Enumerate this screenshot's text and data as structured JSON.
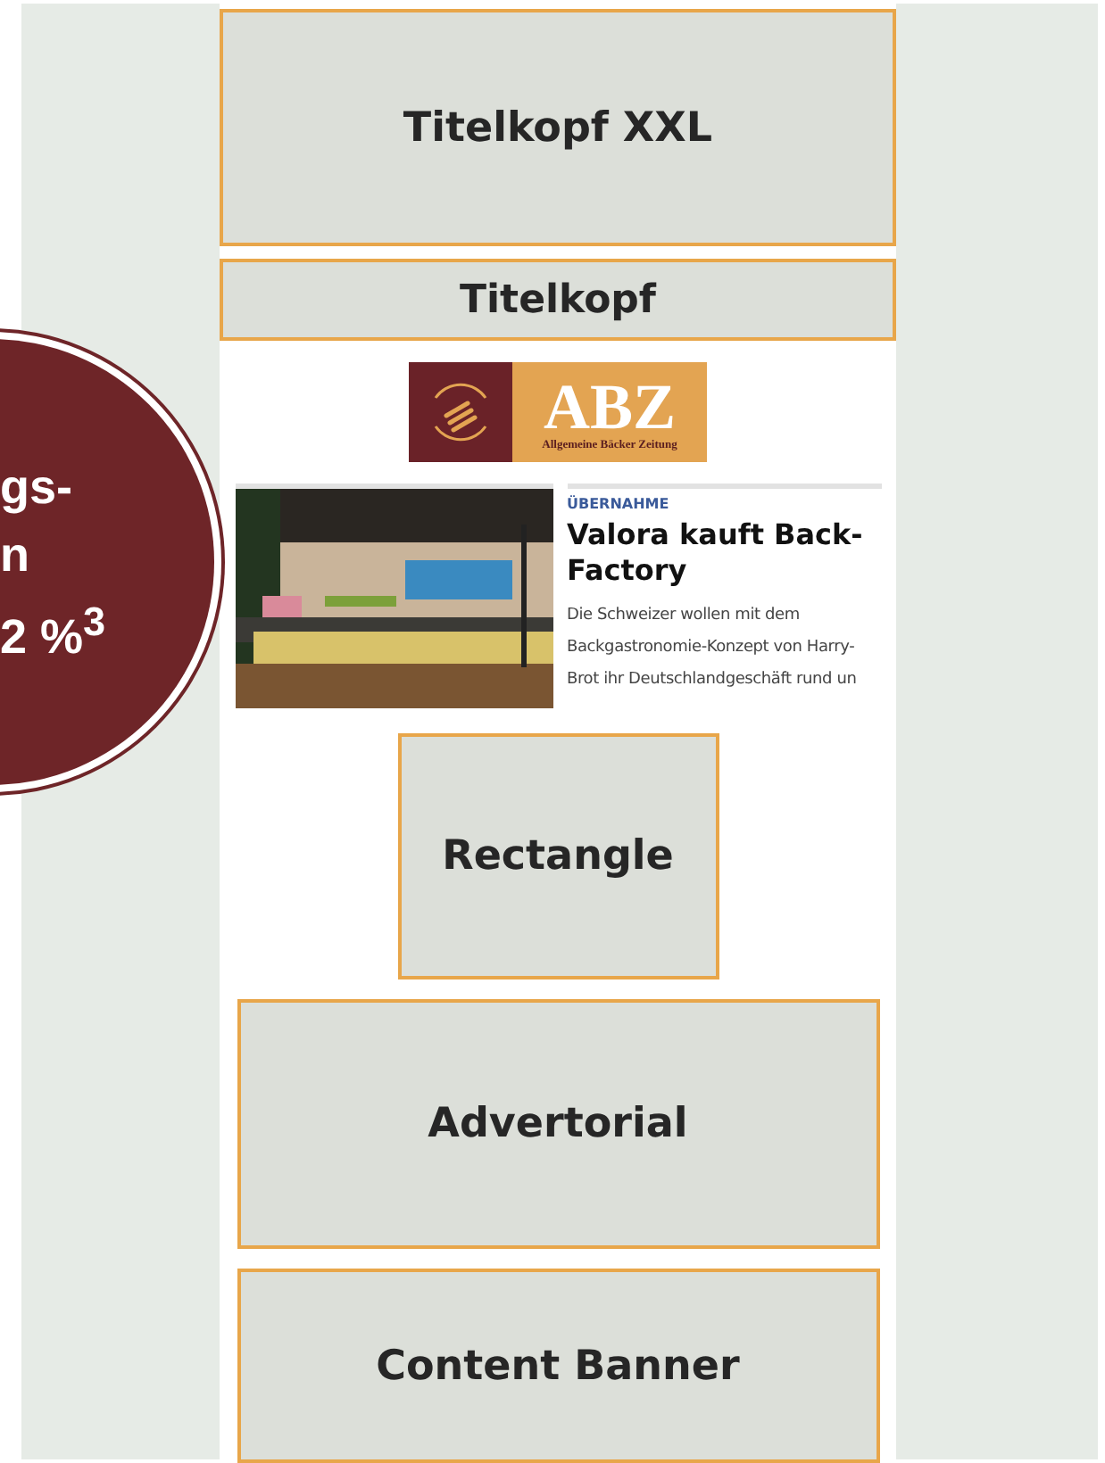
{
  "badge": {
    "lines": [
      "gs-",
      "n",
      "2 %$^{3}$"
    ]
  },
  "slots_top": [
    {
      "label": "Titelkopf XXL",
      "kind": "xxl"
    },
    {
      "label": "Titelkopf",
      "kind": "bar"
    }
  ],
  "logo": {
    "mark": "ABZ",
    "subtitle": "Allgemeine Bäcker Zeitung"
  },
  "teaser": {
    "kicker": "ÜBERNAHME",
    "headline": "Valora kauft Back-Factory",
    "text": "Die Schweizer wollen mit dem\nBackgastronomie-Konzept von Harry-\nBrot ihr Deutschlandgeschäft rund un"
  },
  "slots_bottom": [
    {
      "label": "Rectangle",
      "kind": "rectangle"
    },
    {
      "label": "Advertorial",
      "kind": "wide"
    },
    {
      "label": "Content Banner",
      "kind": "banner"
    }
  ]
}
